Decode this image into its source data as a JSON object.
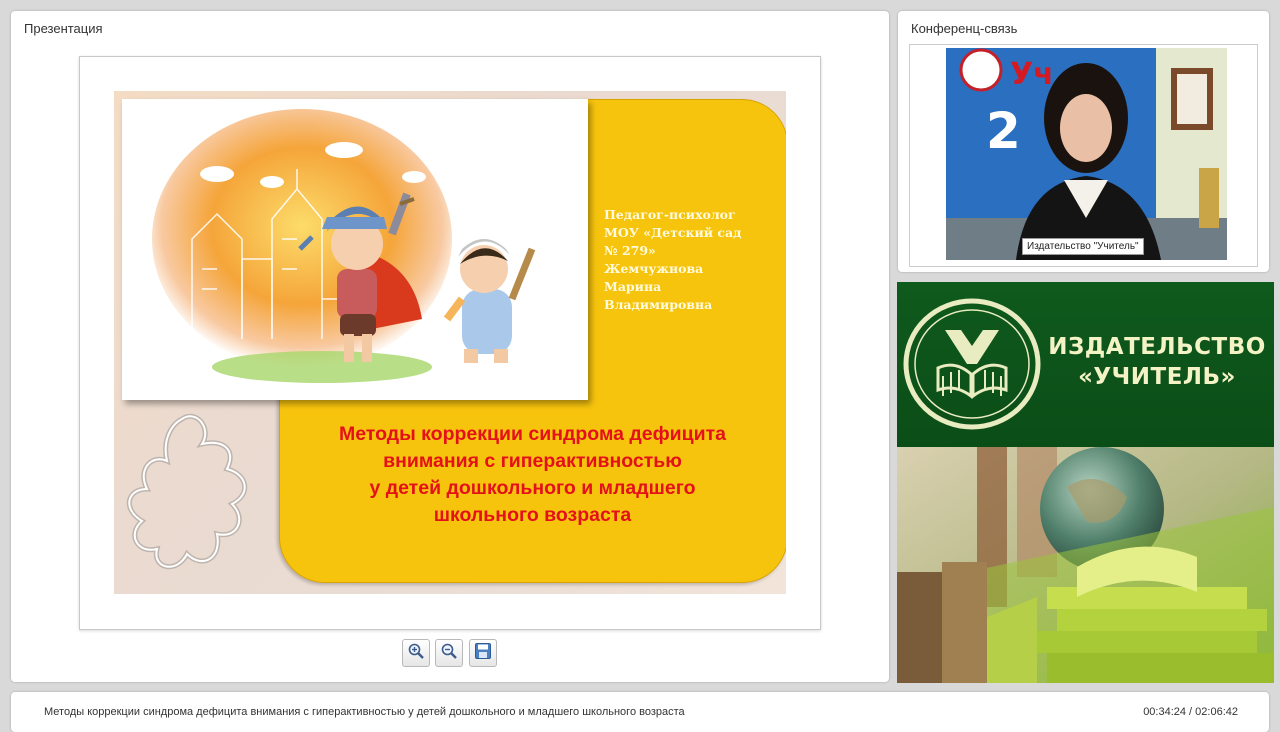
{
  "presentation": {
    "panel_title": "Презентация",
    "slide": {
      "author": "Педагог-психолог\nМОУ «Детский сад\n№ 279»\nЖемчужнова\nМарина\nВладимировна",
      "title": "Методы коррекции синдрома дефицита\nвнимания с гиперактивностью\nу детей дошкольного и младшего\nшкольного возраста"
    },
    "toolbar": {
      "zoom_in_icon": "zoom-in-icon",
      "zoom_out_icon": "zoom-out-icon",
      "save_icon": "save-icon"
    }
  },
  "conference": {
    "panel_title": "Конференц-связь",
    "video_caption": "Издательство \"Учитель\""
  },
  "banner": {
    "text": "ИЗДАТЕЛЬСТВО\n«УЧИТЕЛЬ»"
  },
  "footer": {
    "title": "Методы коррекции синдрома дефицита внимания с гиперактивностью у детей дошкольного и младшего школьного возраста",
    "time": "00:34:24 / 02:06:42"
  },
  "colors": {
    "slide_yellow": "#f7c40d",
    "slide_title": "#e4101a",
    "banner_green": "#0f5a1d",
    "banner_text": "#f4f3c6"
  }
}
